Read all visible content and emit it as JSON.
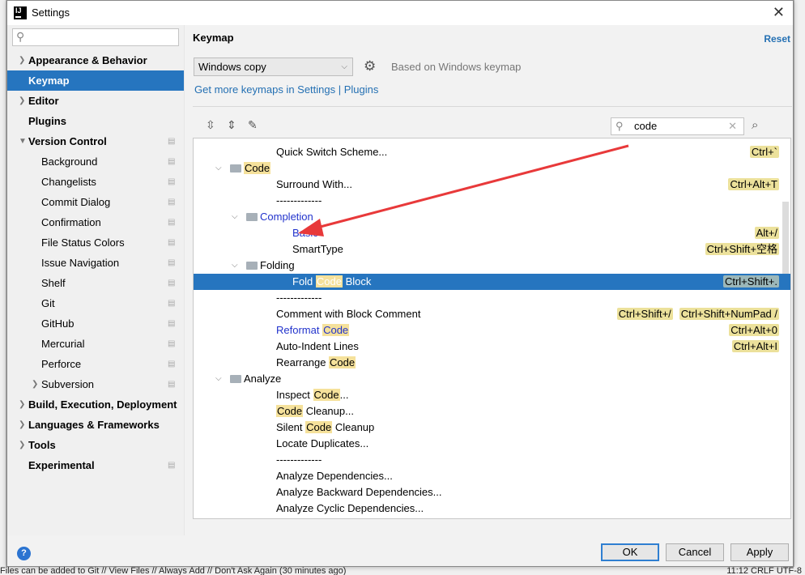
{
  "window": {
    "title": "Settings"
  },
  "sidebar": {
    "items": [
      {
        "label": "Appearance & Behavior",
        "bold": true,
        "arrow": "right",
        "level": 0
      },
      {
        "label": "Keymap",
        "bold": true,
        "level": 0,
        "selected": true
      },
      {
        "label": "Editor",
        "bold": true,
        "arrow": "right",
        "level": 0
      },
      {
        "label": "Plugins",
        "bold": true,
        "level": 0
      },
      {
        "label": "Version Control",
        "bold": true,
        "arrow": "down",
        "level": 0,
        "proj": true
      },
      {
        "label": "Background",
        "level": 1,
        "proj": true
      },
      {
        "label": "Changelists",
        "level": 1,
        "proj": true
      },
      {
        "label": "Commit Dialog",
        "level": 1,
        "proj": true
      },
      {
        "label": "Confirmation",
        "level": 1,
        "proj": true
      },
      {
        "label": "File Status Colors",
        "level": 1,
        "proj": true
      },
      {
        "label": "Issue Navigation",
        "level": 1,
        "proj": true
      },
      {
        "label": "Shelf",
        "level": 1,
        "proj": true
      },
      {
        "label": "Git",
        "level": 1,
        "proj": true
      },
      {
        "label": "GitHub",
        "level": 1,
        "proj": true
      },
      {
        "label": "Mercurial",
        "level": 1,
        "proj": true
      },
      {
        "label": "Perforce",
        "level": 1,
        "proj": true
      },
      {
        "label": "Subversion",
        "level": 1,
        "arrow": "right",
        "proj": true
      },
      {
        "label": "Build, Execution, Deployment",
        "bold": true,
        "arrow": "right",
        "level": 0
      },
      {
        "label": "Languages & Frameworks",
        "bold": true,
        "arrow": "right",
        "level": 0
      },
      {
        "label": "Tools",
        "bold": true,
        "arrow": "right",
        "level": 0
      },
      {
        "label": "Experimental",
        "bold": true,
        "level": 0,
        "proj": true
      }
    ]
  },
  "main": {
    "heading": "Keymap",
    "reset": "Reset",
    "keymap_select": "Windows copy",
    "based_on": "Based on Windows keymap",
    "link": "Get more keymaps in Settings | Plugins",
    "search_value": "code",
    "rows": [
      {
        "level": 1,
        "parts": [
          {
            "t": "Quick Switch Scheme..."
          }
        ],
        "sc": [
          "Ctrl+`"
        ]
      },
      {
        "level": 0,
        "folder": true,
        "open": true,
        "parts": [
          {
            "t": "Code",
            "hl": true
          }
        ]
      },
      {
        "level": 1,
        "parts": [
          {
            "t": "Surround With..."
          }
        ],
        "sc": [
          "Ctrl+Alt+T"
        ]
      },
      {
        "level": 1,
        "parts": [
          {
            "t": "-------------"
          }
        ]
      },
      {
        "level": 1,
        "folder": true,
        "open": true,
        "blue": true,
        "parts": [
          {
            "t": "Completion"
          }
        ]
      },
      {
        "level": 2,
        "blue": true,
        "parts": [
          {
            "t": "Basic"
          }
        ],
        "sc": [
          "Alt+/"
        ]
      },
      {
        "level": 2,
        "parts": [
          {
            "t": "SmartType"
          }
        ],
        "sc": [
          "Ctrl+Shift+空格"
        ]
      },
      {
        "level": 1,
        "folder": true,
        "open": true,
        "parts": [
          {
            "t": "Folding"
          }
        ]
      },
      {
        "level": 2,
        "selected": true,
        "parts": [
          {
            "t": "Fold "
          },
          {
            "t": "Code",
            "hl": true
          },
          {
            "t": " Block"
          }
        ],
        "sc": [
          "Ctrl+Shift+."
        ]
      },
      {
        "level": 1,
        "parts": [
          {
            "t": "-------------"
          }
        ]
      },
      {
        "level": 1,
        "parts": [
          {
            "t": "Comment with Block Comment"
          }
        ],
        "sc": [
          "Ctrl+Shift+/",
          "Ctrl+Shift+NumPad /"
        ]
      },
      {
        "level": 1,
        "blue": true,
        "parts": [
          {
            "t": "Reformat "
          },
          {
            "t": "Code",
            "hl": true
          }
        ],
        "sc": [
          "Ctrl+Alt+0"
        ]
      },
      {
        "level": 1,
        "parts": [
          {
            "t": "Auto-Indent Lines"
          }
        ],
        "sc": [
          "Ctrl+Alt+I"
        ]
      },
      {
        "level": 1,
        "parts": [
          {
            "t": "Rearrange "
          },
          {
            "t": "Code",
            "hl": true
          }
        ]
      },
      {
        "level": 0,
        "folder": true,
        "open": true,
        "parts": [
          {
            "t": "Analyze"
          }
        ]
      },
      {
        "level": 1,
        "parts": [
          {
            "t": "Inspect "
          },
          {
            "t": "Code",
            "hl": true
          },
          {
            "t": "..."
          }
        ]
      },
      {
        "level": 1,
        "parts": [
          {
            "t": "Code",
            "hl": true
          },
          {
            "t": " Cleanup..."
          }
        ]
      },
      {
        "level": 1,
        "parts": [
          {
            "t": "Silent "
          },
          {
            "t": "Code",
            "hl": true
          },
          {
            "t": " Cleanup"
          }
        ]
      },
      {
        "level": 1,
        "parts": [
          {
            "t": "Locate Duplicates..."
          }
        ]
      },
      {
        "level": 1,
        "parts": [
          {
            "t": "-------------"
          }
        ]
      },
      {
        "level": 1,
        "parts": [
          {
            "t": "Analyze Dependencies..."
          }
        ]
      },
      {
        "level": 1,
        "parts": [
          {
            "t": "Analyze Backward Dependencies..."
          }
        ]
      },
      {
        "level": 1,
        "parts": [
          {
            "t": "Analyze Cyclic Dependencies..."
          }
        ]
      }
    ]
  },
  "buttons": {
    "ok": "OK",
    "cancel": "Cancel",
    "apply": "Apply",
    "help": "?"
  },
  "statusbar": {
    "message": "Files can be added to Git // View Files // Always Add // Don't Ask Again (30 minutes ago)",
    "right": "11:12  CRLF  UTF-8"
  },
  "colors": {
    "accent": "#2675bf",
    "highlight": "#f5e19b",
    "annotation_arrow": "#e8393a"
  }
}
